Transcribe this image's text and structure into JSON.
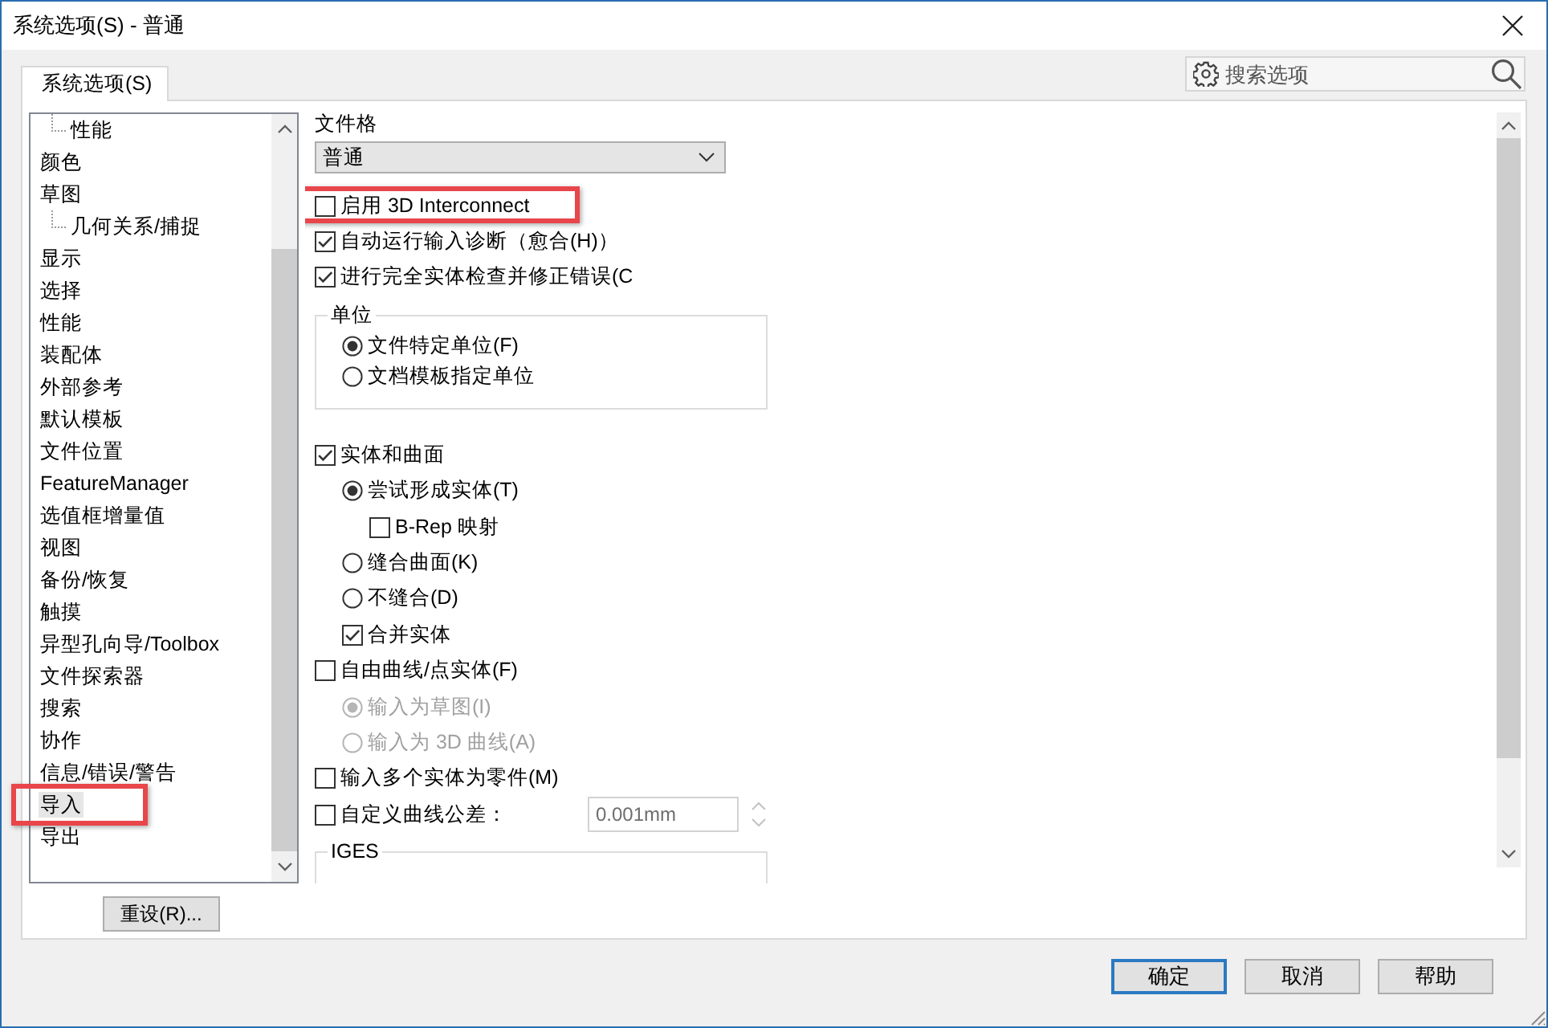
{
  "window": {
    "title": "系统选项(S) - 普通"
  },
  "tabs": [
    {
      "label": "系统选项(S)",
      "selected": true
    }
  ],
  "search": {
    "placeholder": "搜索选项"
  },
  "tree": {
    "items": [
      {
        "children": [
          {
            "label": "性能",
            "selected": false,
            "highlighted": false
          }
        ]
      },
      {
        "label": "颜色",
        "selected": false,
        "highlighted": false
      },
      {
        "label": "草图",
        "selected": false,
        "highlighted": false,
        "children": [
          {
            "label": "几何关系/捕捉",
            "selected": false,
            "highlighted": false
          }
        ]
      },
      {
        "label": "显示",
        "selected": false,
        "highlighted": false
      },
      {
        "label": "选择",
        "selected": false,
        "highlighted": false
      },
      {
        "label": "性能",
        "selected": false,
        "highlighted": false
      },
      {
        "label": "装配体",
        "selected": false,
        "highlighted": false
      },
      {
        "label": "外部参考",
        "selected": false,
        "highlighted": false
      },
      {
        "label": "默认模板",
        "selected": false,
        "highlighted": false
      },
      {
        "label": "文件位置",
        "selected": false,
        "highlighted": false
      },
      {
        "label": "FeatureManager",
        "selected": false,
        "highlighted": false
      },
      {
        "label": "选值框增量值",
        "selected": false,
        "highlighted": false
      },
      {
        "label": "视图",
        "selected": false,
        "highlighted": false
      },
      {
        "label": "备份/恢复",
        "selected": false,
        "highlighted": false
      },
      {
        "label": "触摸",
        "selected": false,
        "highlighted": false
      },
      {
        "label": "异型孔向导/Toolbox",
        "selected": false,
        "highlighted": false
      },
      {
        "label": "文件探索器",
        "selected": false,
        "highlighted": false
      },
      {
        "label": "搜索",
        "selected": false,
        "highlighted": false
      },
      {
        "label": "协作",
        "selected": false,
        "highlighted": false
      },
      {
        "label": "信息/错误/警告",
        "selected": false,
        "highlighted": false
      },
      {
        "label": "导入",
        "selected": true,
        "highlighted": true
      },
      {
        "label": "导出",
        "selected": false,
        "highlighted": false
      }
    ]
  },
  "reset_button": {
    "label": "重设(R)..."
  },
  "options": [
    {
      "kind": "select",
      "label": "文件格",
      "value": "普通"
    },
    {
      "kind": "checkbox",
      "label": "启用 3D Interconnect",
      "checked": false,
      "disabled": false,
      "highlighted": true
    },
    {
      "kind": "checkbox",
      "label": "自动运行输入诊断（愈合(H)）",
      "checked": true,
      "disabled": false,
      "highlighted": false
    },
    {
      "kind": "checkbox",
      "label": "进行完全实体检查并修正错误(C",
      "checked": true,
      "disabled": false,
      "highlighted": false
    },
    {
      "kind": "group",
      "label": "单位",
      "children": [
        {
          "kind": "radio",
          "label": "文件特定单位(F)",
          "selected": true,
          "disabled": false,
          "highlighted": false
        },
        {
          "kind": "radio",
          "label": "文档模板指定单位",
          "selected": false,
          "disabled": false,
          "highlighted": false
        }
      ]
    },
    {
      "kind": "checkbox",
      "label": "实体和曲面",
      "checked": true,
      "disabled": false,
      "highlighted": false,
      "children": [
        {
          "kind": "radio",
          "label": "尝试形成实体(T)",
          "selected": true,
          "disabled": false,
          "highlighted": false,
          "children": [
            {
              "kind": "checkbox",
              "label": "B-Rep 映射",
              "checked": false,
              "disabled": false,
              "highlighted": false
            }
          ]
        },
        {
          "kind": "radio",
          "label": "缝合曲面(K)",
          "selected": false,
          "disabled": false,
          "highlighted": false
        },
        {
          "kind": "radio",
          "label": "不缝合(D)",
          "selected": false,
          "disabled": false,
          "highlighted": false
        },
        {
          "kind": "checkbox",
          "label": "合并实体",
          "checked": true,
          "disabled": false,
          "highlighted": false
        }
      ]
    },
    {
      "kind": "checkbox",
      "label": "自由曲线/点实体(F)",
      "checked": false,
      "disabled": false,
      "highlighted": false,
      "children": [
        {
          "kind": "radio",
          "label": "输入为草图(I)",
          "selected": true,
          "disabled": true,
          "highlighted": false
        },
        {
          "kind": "radio",
          "label": "输入为 3D 曲线(A)",
          "selected": false,
          "disabled": true,
          "highlighted": false
        }
      ]
    },
    {
      "kind": "checkbox",
      "label": "输入多个实体为零件(M)",
      "checked": false,
      "disabled": false,
      "highlighted": false
    },
    {
      "kind": "checkbox",
      "label": "自定义曲线公差：",
      "checked": false,
      "disabled": false,
      "highlighted": false,
      "field": {
        "value": "0.001mm",
        "disabled": true
      }
    },
    {
      "kind": "group",
      "label": "IGES"
    }
  ],
  "buttons": [
    {
      "label": "确定",
      "default": true
    },
    {
      "label": "取消",
      "default": false
    },
    {
      "label": "帮助",
      "default": false
    }
  ]
}
